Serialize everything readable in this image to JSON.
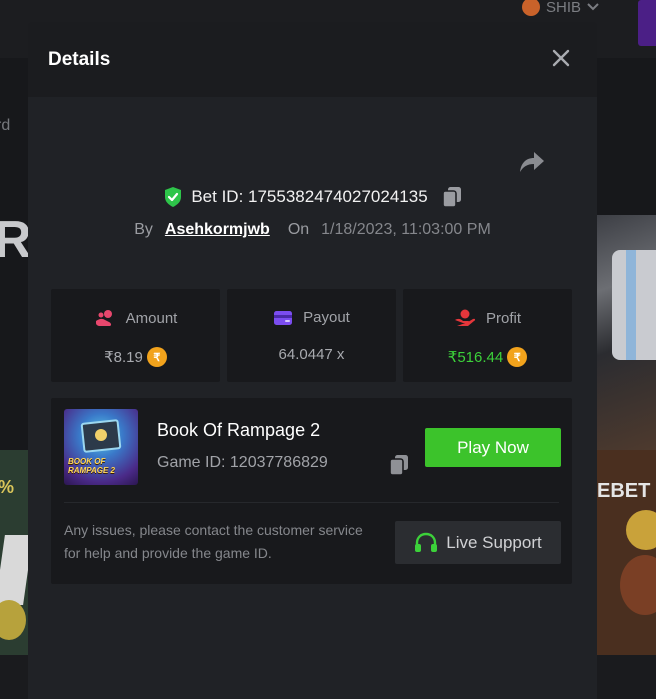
{
  "background": {
    "currency": "SHIB",
    "text_fragment": "rd",
    "big_text": "RC",
    "percent_fragment": "%",
    "ebet_text": "EBET"
  },
  "modal": {
    "title": "Details",
    "bet_id_label": "Bet ID: 1755382474027024135",
    "by_label": "By",
    "username": "Asehkormjwb",
    "on_label": "On",
    "datetime": "1/18/2023, 11:03:00 PM",
    "stats": {
      "amount": {
        "label": "Amount",
        "value": "₹8.19",
        "badge": "₹"
      },
      "payout": {
        "label": "Payout",
        "value": "64.0447 x"
      },
      "profit": {
        "label": "Profit",
        "value": "₹516.44",
        "badge": "₹"
      }
    },
    "game": {
      "name": "Book Of Rampage 2",
      "id_label": "Game ID: 12037786829",
      "thumb_title": "BOOK OF RAMPAGE 2",
      "play_label": "Play Now"
    },
    "support": {
      "text": "Any issues, please contact the customer service for help and provide the game ID.",
      "button_label": "Live Support"
    }
  },
  "colors": {
    "accent_green": "#3cc32b",
    "profit_green": "#3cd13a",
    "rupee_badge": "#f2a31c",
    "amount_icon": "#e8476d",
    "payout_icon": "#7b4df0",
    "profit_icon": "#e5363b",
    "verified_green": "#2ec54a"
  },
  "icons": [
    "close-icon",
    "share-icon",
    "shield-check-icon",
    "copy-icon",
    "amount-icon",
    "payout-wallet-icon",
    "profit-icon",
    "headset-icon"
  ]
}
